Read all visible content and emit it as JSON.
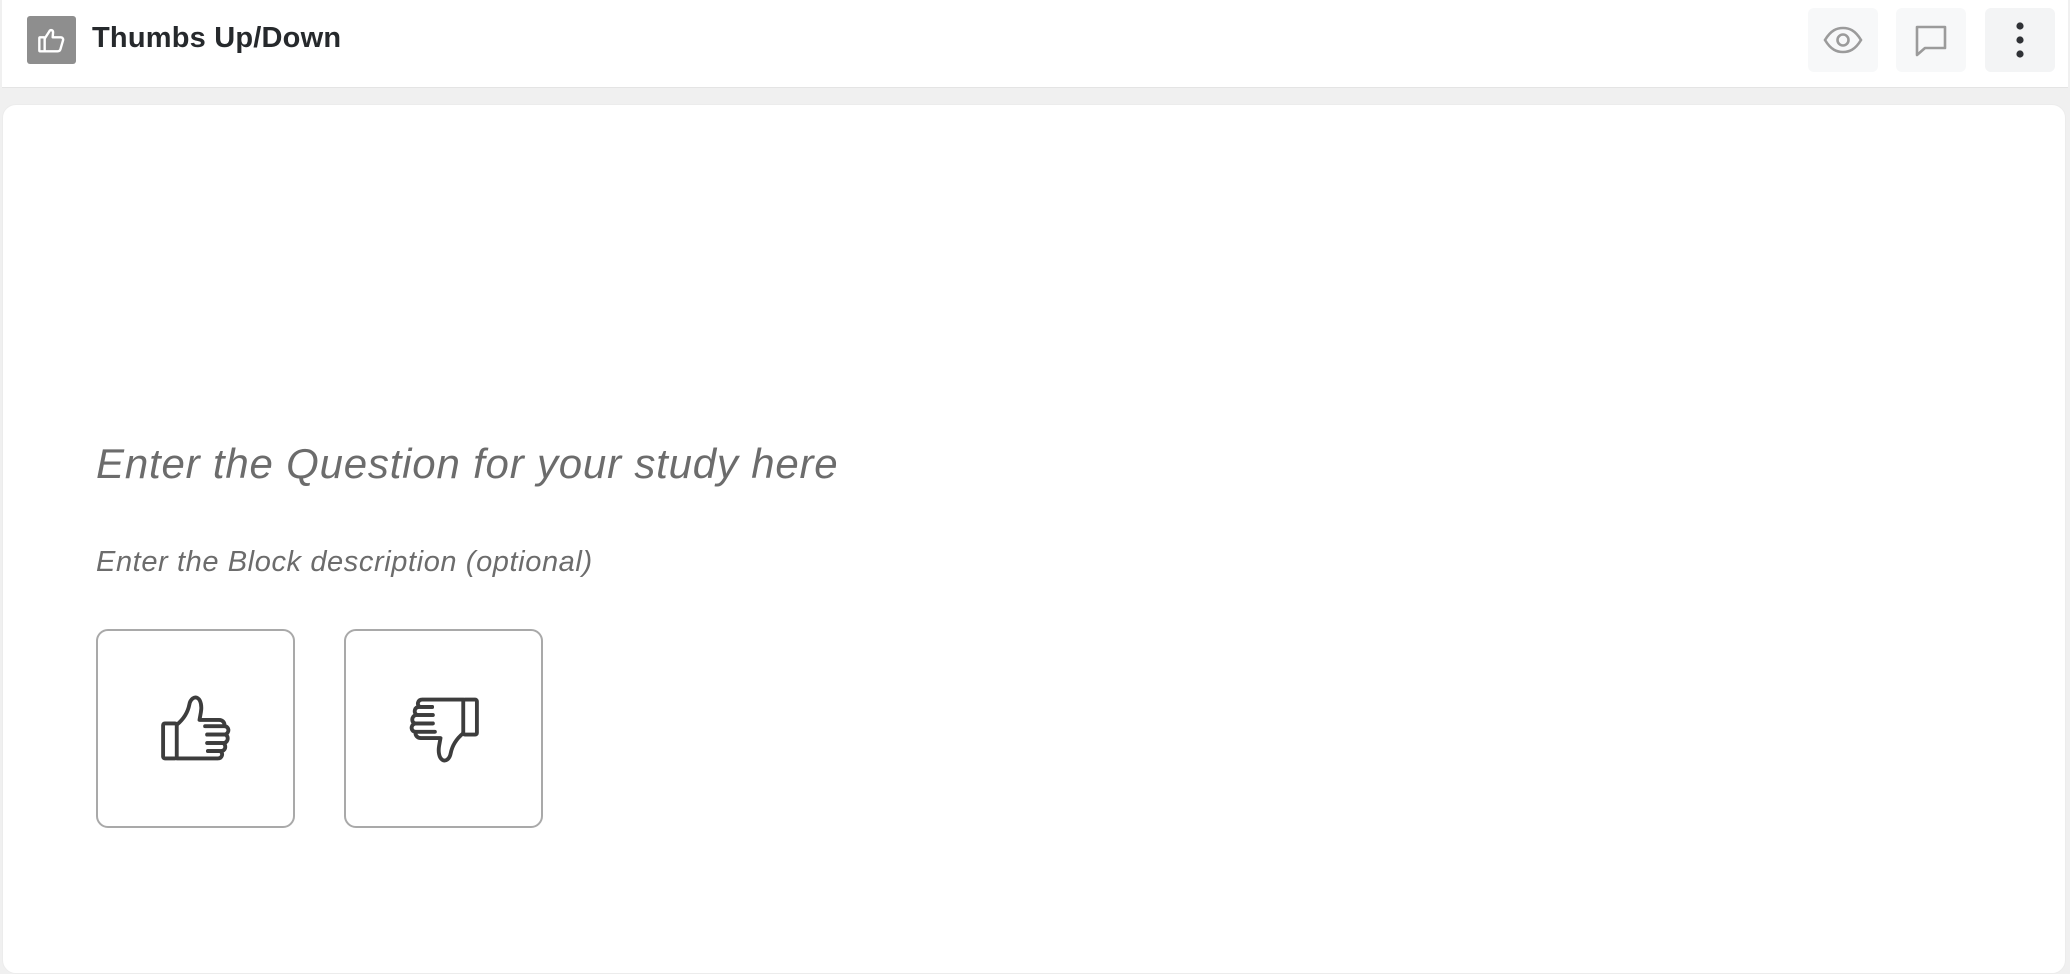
{
  "header": {
    "block_icon": "thumbs-up-icon",
    "title": "Thumbs Up/Down",
    "actions": [
      {
        "name": "preview",
        "icon": "eye-icon"
      },
      {
        "name": "comments",
        "icon": "comment-icon"
      },
      {
        "name": "more",
        "icon": "more-vertical-icon"
      }
    ]
  },
  "block": {
    "question_placeholder": "Enter the Question for your study here",
    "description_placeholder": "Enter the Block description (optional)",
    "choices": [
      {
        "value": "thumbs-up",
        "icon": "thumbs-up-icon"
      },
      {
        "value": "thumbs-down",
        "icon": "thumbs-down-icon"
      }
    ]
  },
  "colors": {
    "page_background": "#f0f0f0",
    "card_background": "#ffffff",
    "placeholder_text": "#6c6c6c",
    "title_text": "#26292c",
    "block_icon_background": "#8e8e8e",
    "choice_border": "#a9a9a9"
  }
}
